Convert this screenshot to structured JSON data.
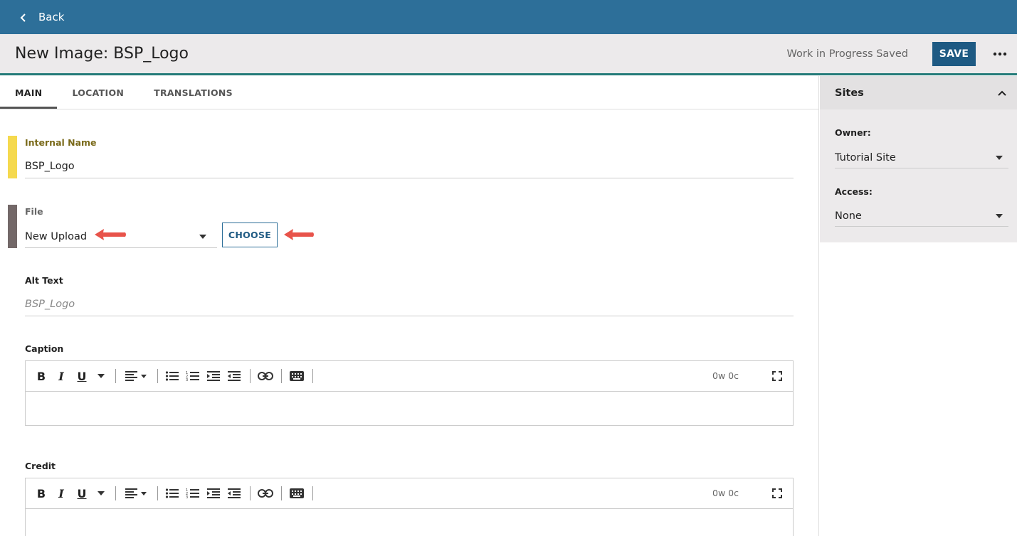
{
  "topbar": {
    "back_label": "Back"
  },
  "header": {
    "title": "New Image: BSP_Logo",
    "status": "Work in Progress Saved",
    "save_label": "SAVE"
  },
  "tabs": [
    {
      "label": "MAIN"
    },
    {
      "label": "LOCATION"
    },
    {
      "label": "TRANSLATIONS"
    }
  ],
  "form": {
    "internal_name": {
      "label": "Internal Name",
      "value": "BSP_Logo"
    },
    "file": {
      "label": "File",
      "value": "New Upload",
      "choose_label": "CHOOSE"
    },
    "alt_text": {
      "label": "Alt Text",
      "placeholder": "BSP_Logo"
    },
    "caption": {
      "label": "Caption",
      "count": "0w 0c"
    },
    "credit": {
      "label": "Credit",
      "count": "0w 0c"
    }
  },
  "sidebar": {
    "title": "Sites",
    "owner": {
      "label": "Owner:",
      "value": "Tutorial Site"
    },
    "access": {
      "label": "Access:",
      "value": "None"
    }
  },
  "colors": {
    "topbar": "#2d6f99",
    "save": "#1e5a83",
    "accent_line": "#237a78",
    "internal_name_bar": "#f5d94e",
    "file_bar": "#736868",
    "annotation_arrow": "#e8534a"
  }
}
